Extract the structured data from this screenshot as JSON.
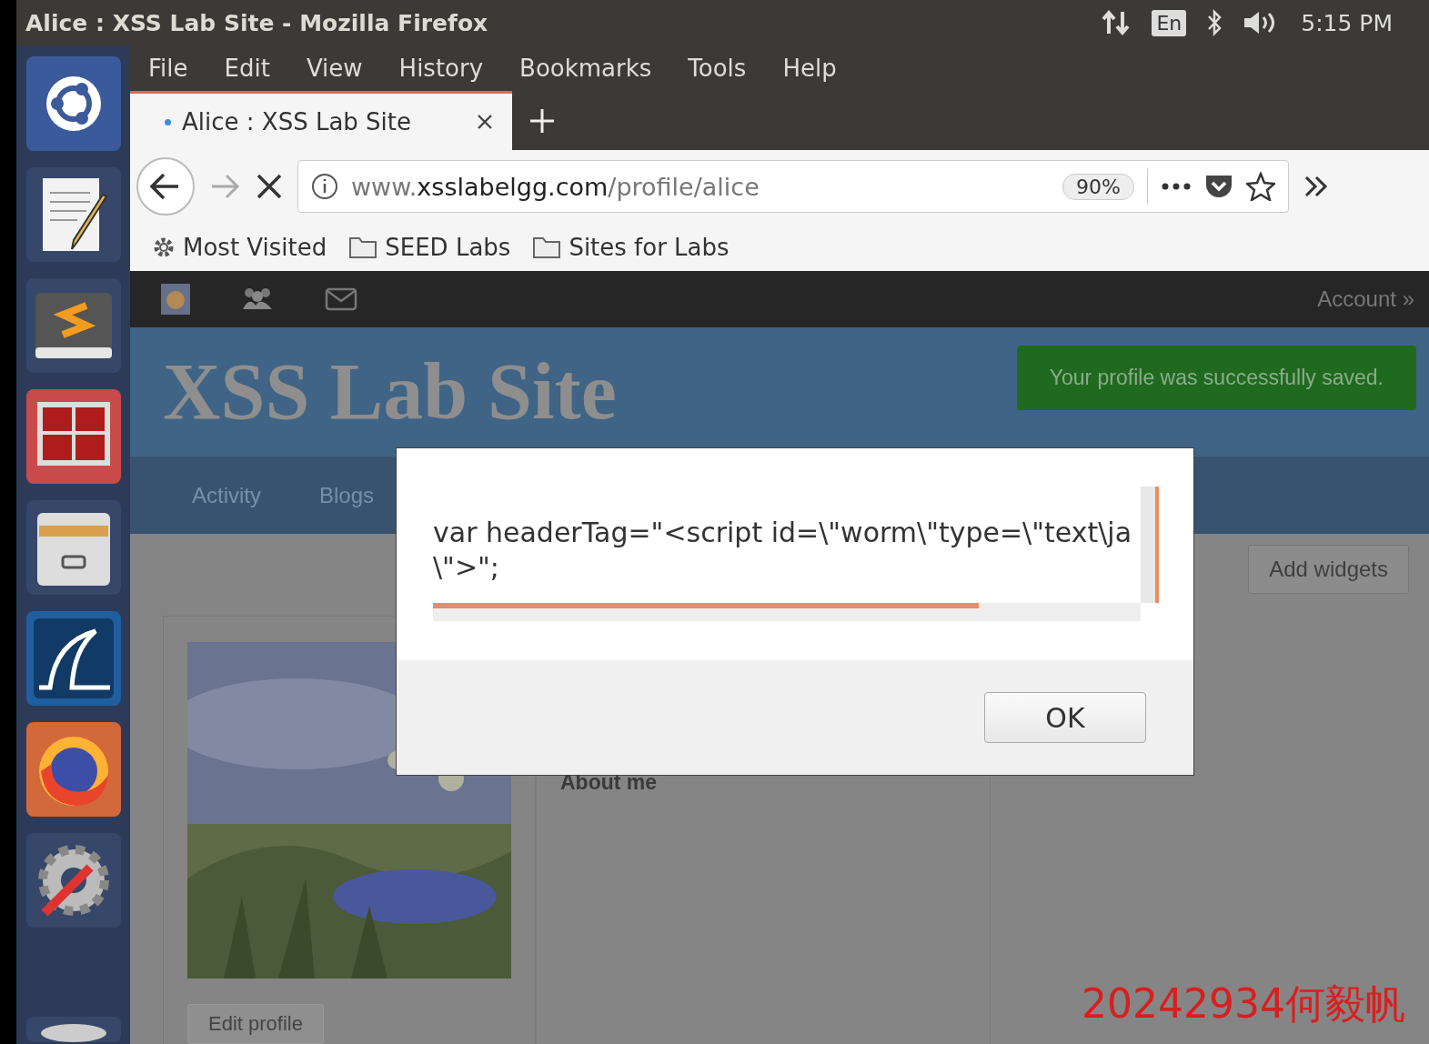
{
  "top_panel": {
    "title": "Alice : XSS Lab Site - Mozilla Firefox",
    "keyboard": "En",
    "time": "5:15 PM"
  },
  "launcher": [
    {
      "kind": "ubuntu"
    },
    {
      "kind": "editor"
    },
    {
      "kind": "sublime"
    },
    {
      "kind": "terminal"
    },
    {
      "kind": "files"
    },
    {
      "kind": "wireshark"
    },
    {
      "kind": "firefox"
    },
    {
      "kind": "settings"
    },
    {
      "kind": "disk"
    }
  ],
  "menu": [
    "File",
    "Edit",
    "View",
    "History",
    "Bookmarks",
    "Tools",
    "Help"
  ],
  "tabs": [
    {
      "label": "Alice : XSS Lab Site",
      "selected": true
    }
  ],
  "address": {
    "prefix": "www.",
    "domain": "xsslabelgg.com",
    "path": "/profile/alice",
    "zoom": "90%"
  },
  "bookmarks": [
    {
      "kind": "gear",
      "label": "Most Visited"
    },
    {
      "kind": "folder",
      "label": "SEED Labs"
    },
    {
      "kind": "folder",
      "label": "Sites for Labs"
    }
  ],
  "site": {
    "account": "Account »",
    "title": "XSS Lab Site",
    "message": "Your profile was successfully saved.",
    "nav": [
      "Activity",
      "Blogs"
    ],
    "add_widgets": "Add widgets",
    "about": "About me",
    "edit_profile": "Edit profile"
  },
  "dialog": {
    "lines": [
      "var headerTag=\"<script id=\\\"worm\\\"type=\\\"text\\ja",
      "\\\">\";"
    ],
    "button": "OK"
  },
  "annotation": "20242934何毅帆"
}
